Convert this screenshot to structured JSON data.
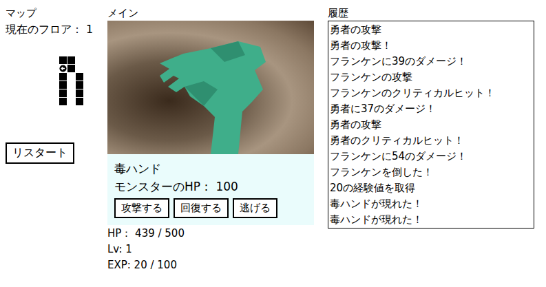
{
  "map": {
    "title": "マップ",
    "floor": "現在のフロア： 1",
    "rows": [
      [
        "room",
        "room",
        "empty"
      ],
      [
        "player",
        "room",
        "empty"
      ],
      [
        "room",
        "empty",
        "room"
      ],
      [
        "room",
        "empty",
        "room"
      ],
      [
        "room",
        "empty",
        "room"
      ],
      [
        "room",
        "empty",
        "room"
      ]
    ],
    "restart": "リスタート"
  },
  "main": {
    "title": "メイン",
    "monster": {
      "name": "毒ハンド",
      "hp": "モンスターのHP： 100"
    },
    "actions": [
      "攻撃する",
      "回復する",
      "逃げる"
    ],
    "player": {
      "hp": "HP： 439 / 500",
      "level": "Lv: 1",
      "exp": "EXP: 20 / 100"
    }
  },
  "history": {
    "title": "履歴",
    "lines": [
      "勇者の攻撃",
      "勇者の攻撃！",
      "フランケンに39のダメージ！",
      "フランケンの攻撃",
      "フランケンのクリティカルヒット！",
      "勇者に37のダメージ！",
      "勇者の攻撃",
      "勇者のクリティカルヒット！",
      "フランケンに54のダメージ！",
      "フランケンを倒した！",
      "20の経験値を取得",
      "毒ハンドが現れた！",
      "毒ハンドが現れた！"
    ]
  }
}
